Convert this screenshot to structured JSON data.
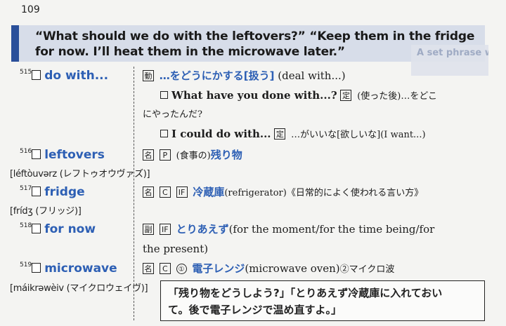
{
  "page_number": "109",
  "banner": {
    "text": "“What should we do with the leftovers?” “Keep them in the fridge for now. I’ll heat them in the microwave later.”"
  },
  "ghost_text": "A set phrase without use",
  "entries": [
    {
      "num": "515",
      "word": "do with...",
      "pron": "",
      "lines": [
        {
          "parts": [
            "動",
            "…をどうにかする[扱う]",
            "(deal with...)"
          ]
        },
        {
          "parts": [
            "What have you done with...?",
            "定",
            "(使った後)…をどこ"
          ]
        },
        {
          "parts": [
            "にやったんだ?"
          ]
        },
        {
          "parts": [
            "I could do with...",
            "定",
            "…がいいな[欲しいな](I want...)"
          ]
        }
      ]
    },
    {
      "num": "516",
      "word": "leftovers",
      "pron": "[léftòuvərz (レフトゥオウヴァズ)]",
      "lines": [
        {
          "parts": [
            "名",
            "P",
            "(食事の)",
            "残り物"
          ]
        }
      ]
    },
    {
      "num": "517",
      "word": "fridge",
      "pron": "[frídʒ (フリッジ)]",
      "lines": [
        {
          "parts": [
            "名",
            "C",
            "IF",
            "冷蔵庫",
            "(refrigerator)《日常的によく使われる言い方》"
          ]
        }
      ]
    },
    {
      "num": "518",
      "word": "for now",
      "pron": "",
      "lines": [
        {
          "parts": [
            "副",
            "IF",
            "とりあえず",
            "(for the moment/for the time being/for"
          ]
        },
        {
          "parts": [
            "the present)"
          ]
        }
      ]
    },
    {
      "num": "519",
      "word": "microwave",
      "pron": "[máikrəwèiv (マイクロウェイヴ)]",
      "lines": [
        {
          "parts": [
            "名",
            "C",
            "①",
            "電子レンジ",
            "(microwave oven)",
            "②マイクロ波"
          ]
        }
      ]
    }
  ],
  "translation": {
    "line1": "「残り物をどうしよう?」「とりあえず冷蔵庫に入れておい",
    "line2": "て。後で電子レンジで温め直すよ。」"
  }
}
